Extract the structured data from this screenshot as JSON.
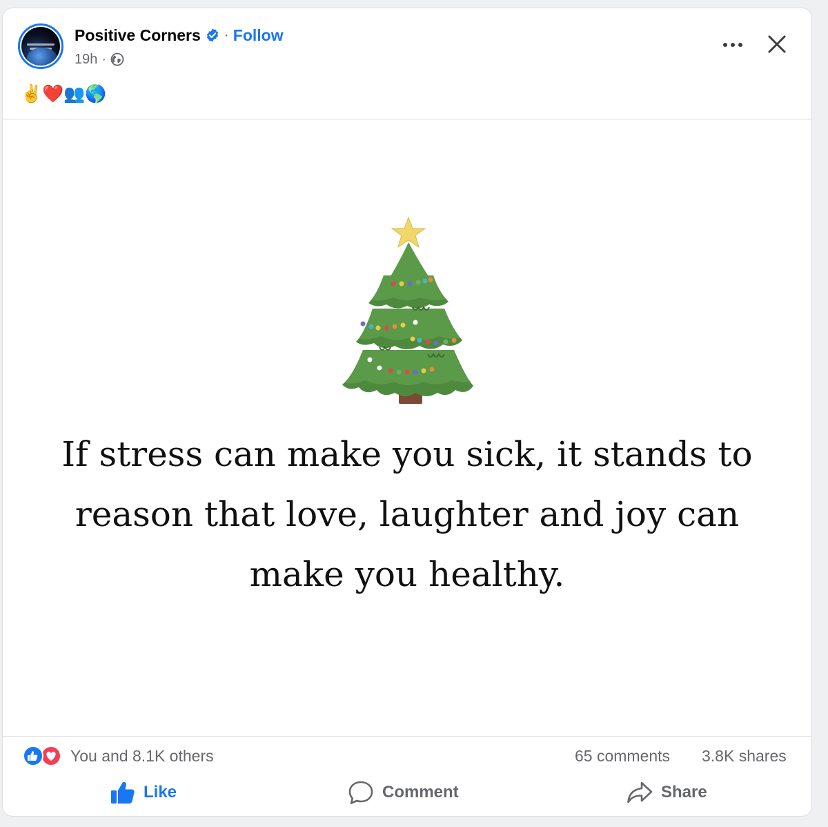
{
  "post": {
    "page_name": "Positive Corners",
    "follow_label": "Follow",
    "separator": "·",
    "time": "19h",
    "time_separator": "·",
    "caption_emojis": "✌️❤️👥🌎",
    "quote": "If stress can make you sick, it stands to reason that love, laughter and joy can make you healthy."
  },
  "stats": {
    "reactions_text": "You and 8.1K others",
    "comments": "65 comments",
    "shares": "3.8K shares"
  },
  "actions": {
    "like": "Like",
    "comment": "Comment",
    "share": "Share"
  },
  "colors": {
    "brand_blue": "#1877f2",
    "secondary_text": "#65676b",
    "love_red": "#f33e58"
  },
  "icons": [
    "verified-badge-icon",
    "globe-icon",
    "more-options-icon",
    "close-icon",
    "like-reaction-icon",
    "love-reaction-icon",
    "thumbs-up-icon",
    "comment-icon",
    "share-icon"
  ]
}
